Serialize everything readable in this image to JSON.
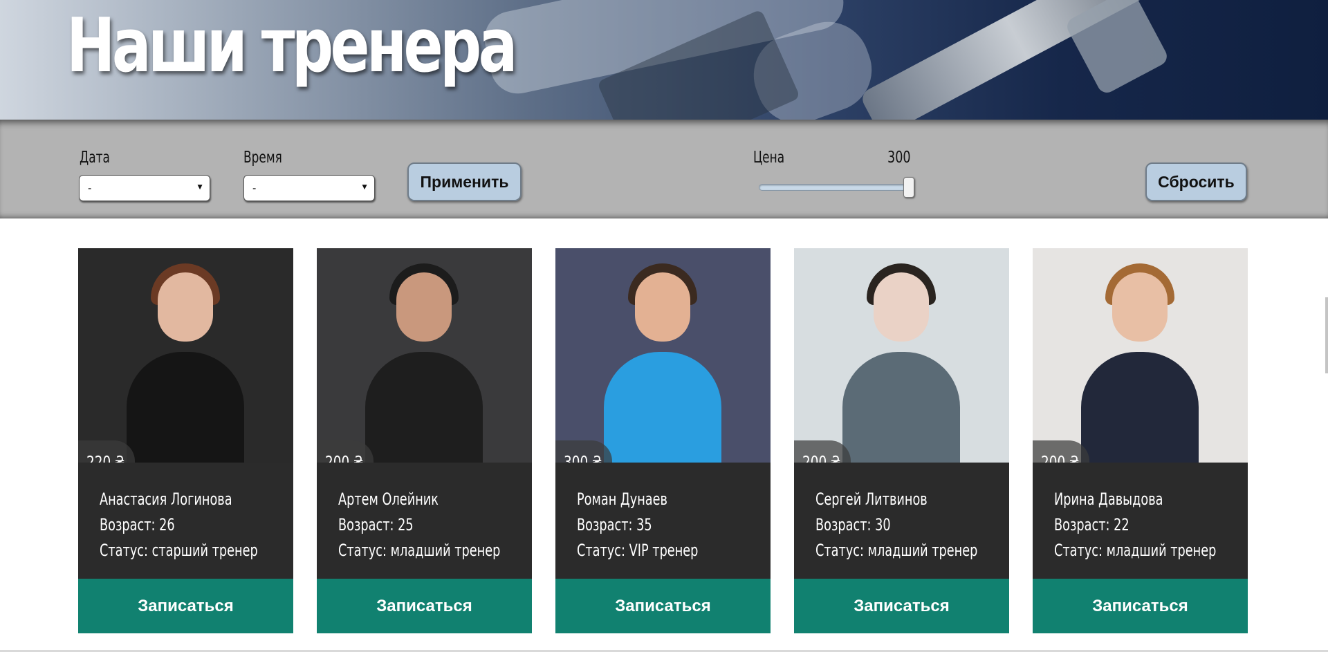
{
  "hero": {
    "title": "Наши тренера"
  },
  "filters": {
    "date_label": "Дата",
    "date_value": "-",
    "time_label": "Время",
    "time_value": "-",
    "apply_label": "Применить",
    "price_label": "Цена",
    "price_value": "300",
    "price_slider_fraction": 1.0,
    "reset_label": "Сбросить"
  },
  "trainers": [
    {
      "price": "220 ₴",
      "name": "Анастасия Логинова",
      "age": "Возраст: 26",
      "status": "Статус: старший тренер",
      "signup": "Записаться",
      "photo_bg": "#2a2a2a",
      "shirt": "#151515",
      "skin": "#e2b8a0",
      "hair": "#6b3a24"
    },
    {
      "price": "200 ₴",
      "name": "Артем Олейник",
      "age": "Возраст: 25",
      "status": "Статус: младший тренер",
      "signup": "Записаться",
      "photo_bg": "#3a3a3c",
      "shirt": "#1e1e1e",
      "skin": "#c9987d",
      "hair": "#1c1c1c"
    },
    {
      "price": "300 ₴",
      "name": "Роман Дунаев",
      "age": "Возраст: 35",
      "status": "Статус: VIP тренер",
      "signup": "Записаться",
      "photo_bg": "#4a4f6a",
      "shirt": "#2a9ee0",
      "skin": "#e3b193",
      "hair": "#3b2a20"
    },
    {
      "price": "200 ₴",
      "name": "Сергей Литвинов",
      "age": "Возраст: 30",
      "status": "Статус: младший тренер",
      "signup": "Записаться",
      "photo_bg": "#d7dde0",
      "shirt": "#5b6b76",
      "skin": "#ead2c6",
      "hair": "#2a2420"
    },
    {
      "price": "200 ₴",
      "name": "Ирина Давыдова",
      "age": "Возраст: 22",
      "status": "Статус: младший тренер",
      "signup": "Записаться",
      "photo_bg": "#e6e4e2",
      "shirt": "#22283a",
      "skin": "#e8bfa5",
      "hair": "#a46a35"
    }
  ]
}
